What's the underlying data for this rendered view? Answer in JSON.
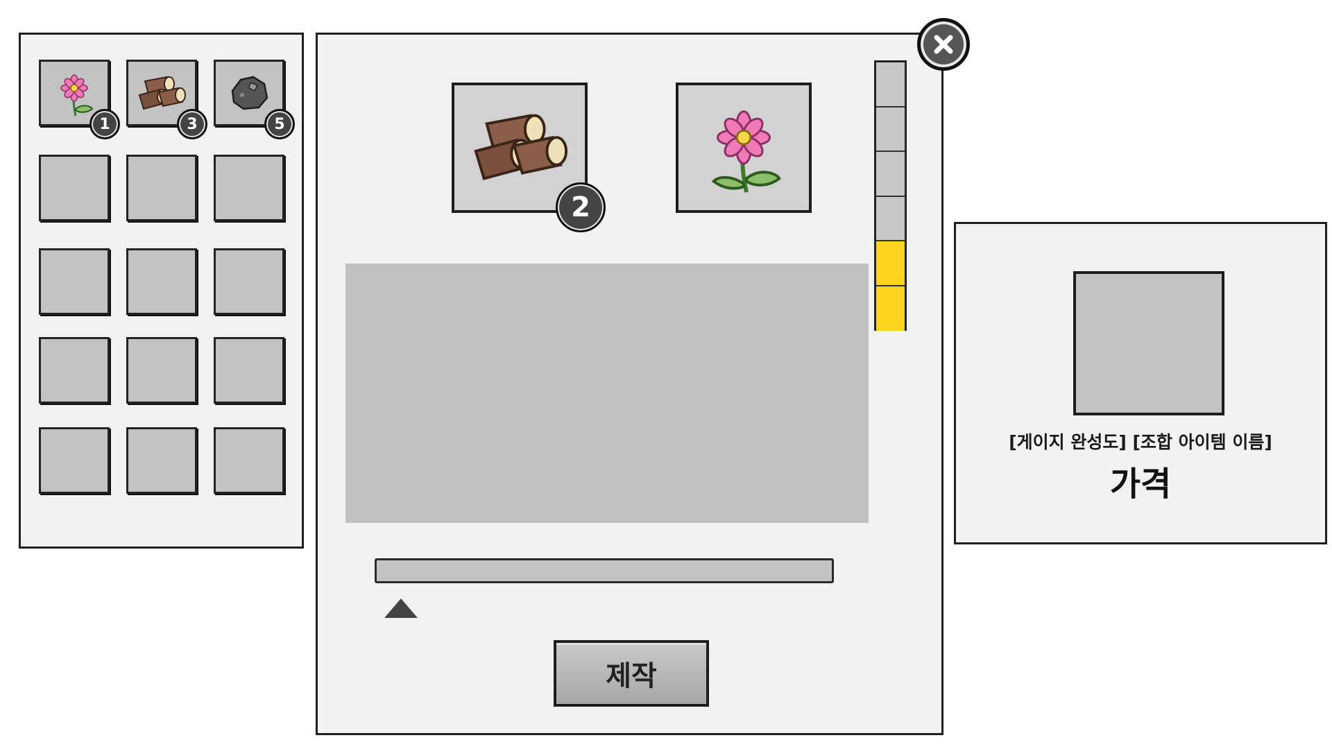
{
  "inventory": {
    "items": [
      {
        "icon": "flower-icon",
        "count": "1"
      },
      {
        "icon": "logs-icon",
        "count": "3"
      },
      {
        "icon": "rock-icon",
        "count": "5"
      }
    ],
    "empty_slots": 12
  },
  "crafting": {
    "ingredients": [
      {
        "icon": "logs-icon",
        "count": "2"
      },
      {
        "icon": "flower-icon",
        "count": ""
      }
    ],
    "gauge": {
      "segments": 6,
      "filled": 2,
      "fill_color": "#ffd41f",
      "empty_color": "#c8c8c8"
    },
    "progress": 0.02,
    "craft_button_label": "제작",
    "close_icon": "close-icon"
  },
  "result": {
    "arrow_icon": "play-arrow-icon",
    "label": "[게이지 완성도] [조합 아이템 이름]",
    "price_label": "가격"
  }
}
